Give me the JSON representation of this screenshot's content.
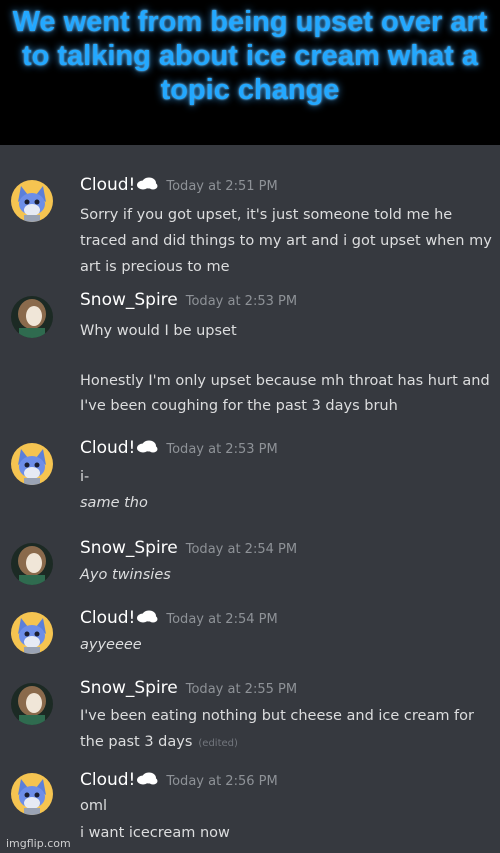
{
  "caption": "We went from being upset over art to talking about ice cream what a topic change",
  "messages": [
    {
      "author": "Cloud!",
      "timestamp": "Today at 2:51 PM",
      "lines": [
        "Sorry if you got upset, it's just someone told me he",
        "traced and did things to my art and i got upset when my",
        "art is precious to me"
      ]
    },
    {
      "author": "Snow_Spire",
      "timestamp": "Today at 2:53 PM",
      "lines": [
        "Why would I be upset",
        "Honestly I'm only upset because mh throat has hurt and",
        "I've been coughing for the past 3 days bruh"
      ]
    },
    {
      "author": "Cloud!",
      "timestamp": "Today at 2:53 PM",
      "lines": [
        "i-",
        "same tho"
      ]
    },
    {
      "author": "Snow_Spire",
      "timestamp": "Today at 2:54 PM",
      "lines": [
        "Ayo twinsies"
      ]
    },
    {
      "author": "Cloud!",
      "timestamp": "Today at 2:54 PM",
      "lines": [
        "ayyeeee"
      ]
    },
    {
      "author": "Snow_Spire",
      "timestamp": "Today at 2:55 PM",
      "lines": [
        "I've been eating nothing but cheese and ice cream for",
        "the past 3 days"
      ],
      "edited": "(edited)"
    },
    {
      "author": "Cloud!",
      "timestamp": "Today at 2:56 PM",
      "lines": [
        "oml",
        "i want icecream now"
      ]
    }
  ],
  "watermark": "imgflip.com",
  "colors": {
    "background": "#36393f",
    "caption_text": "#23a8ff",
    "username": "#ffffff",
    "timestamp": "#8e9297",
    "message_text": "#dcddde"
  },
  "icons": {
    "cloud_emoji": "cloud-icon",
    "cloud_avatar": "cat-avatar",
    "snow_avatar": "person-avatar"
  }
}
